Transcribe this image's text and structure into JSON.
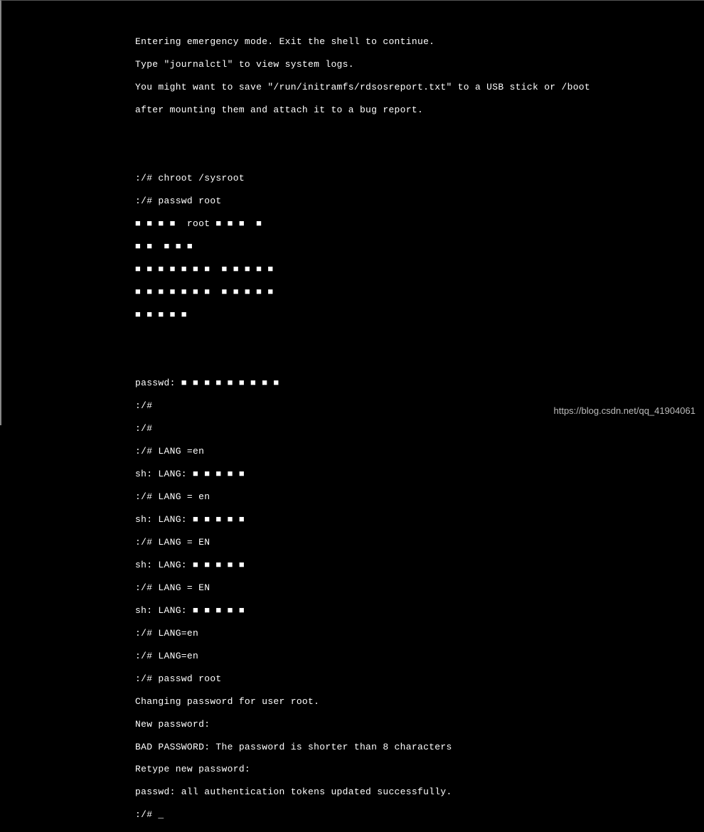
{
  "terminal": {
    "lines": [
      "Entering emergency mode. Exit the shell to continue.",
      "Type \"journalctl\" to view system logs.",
      "You might want to save \"/run/initramfs/rdsosreport.txt\" to a USB stick or /boot",
      "after mounting them and attach it to a bug report.",
      "",
      "",
      ":/# chroot /sysroot",
      ":/# passwd root",
      "■ ■ ■ ■  root ■ ■ ■  ■",
      "■ ■  ■ ■ ■",
      "■ ■ ■ ■ ■ ■ ■  ■ ■ ■ ■ ■",
      "■ ■ ■ ■ ■ ■ ■  ■ ■ ■ ■ ■",
      "■ ■ ■ ■ ■",
      "",
      "",
      "passwd: ■ ■ ■ ■ ■ ■ ■ ■ ■",
      ":/#",
      ":/#",
      ":/# LANG =en",
      "sh: LANG: ■ ■ ■ ■ ■",
      ":/# LANG = en",
      "sh: LANG: ■ ■ ■ ■ ■",
      ":/# LANG = EN",
      "sh: LANG: ■ ■ ■ ■ ■",
      ":/# LANG = EN",
      "sh: LANG: ■ ■ ■ ■ ■",
      ":/# LANG=en",
      ":/# LANG=en",
      ":/# passwd root",
      "Changing password for user root.",
      "New password:",
      "BAD PASSWORD: The password is shorter than 8 characters",
      "Retype new password:",
      "passwd: all authentication tokens updated successfully.",
      ":/# _"
    ]
  },
  "watermark": "https://blog.csdn.net/qq_41904061"
}
